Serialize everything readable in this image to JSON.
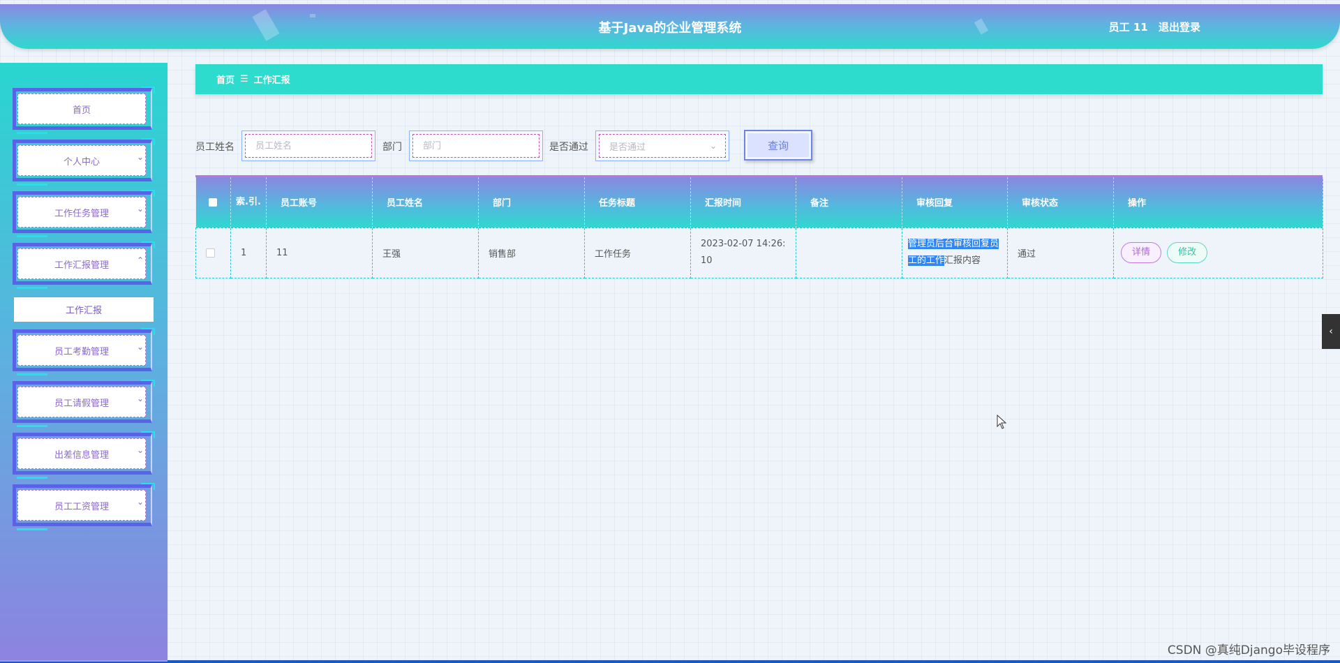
{
  "header": {
    "title": "基于Java的企业管理系统",
    "user": "员工 11",
    "logout": "退出登录"
  },
  "sidebar": {
    "items": [
      {
        "label": "首页",
        "expandable": false
      },
      {
        "label": "个人中心",
        "expandable": true
      },
      {
        "label": "工作任务管理",
        "expandable": true
      },
      {
        "label": "工作汇报管理",
        "expandable": true,
        "expanded": true
      },
      {
        "label": "员工考勤管理",
        "expandable": true
      },
      {
        "label": "员工请假管理",
        "expandable": true
      },
      {
        "label": "出差信息管理",
        "expandable": true
      },
      {
        "label": "员工工资管理",
        "expandable": true
      }
    ],
    "submenu": {
      "label": "工作汇报"
    }
  },
  "breadcrumb": {
    "home": "首页",
    "separator": "☰",
    "current": "工作汇报"
  },
  "search": {
    "name_label": "员工姓名",
    "name_placeholder": "员工姓名",
    "dept_label": "部门",
    "dept_placeholder": "部门",
    "pass_label": "是否通过",
    "pass_placeholder": "是否通过",
    "query_label": "查询"
  },
  "table": {
    "headers": [
      "索.引.",
      "员工账号",
      "员工姓名",
      "部门",
      "任务标题",
      "汇报时间",
      "备注",
      "审核回复",
      "审核状态",
      "操作"
    ],
    "rows": [
      {
        "index": "1",
        "account": "11",
        "name": "王强",
        "dept": "销售部",
        "task": "工作任务",
        "time": "2023-02-07 14:26:10",
        "note": "",
        "reply_selected": "管理员后台审核回复员工的工作",
        "reply_rest": "汇报内容",
        "status": "通过",
        "detail_label": "详情",
        "edit_label": "修改"
      }
    ]
  },
  "side_tab": {
    "icon": "chevron-left-icon",
    "glyph": "‹"
  },
  "watermark": "CSDN @真纯Django毕设程序",
  "colors": {
    "accent_teal": "#2ddccd",
    "accent_purple": "#8a87e0",
    "selection": "#3386f0"
  }
}
